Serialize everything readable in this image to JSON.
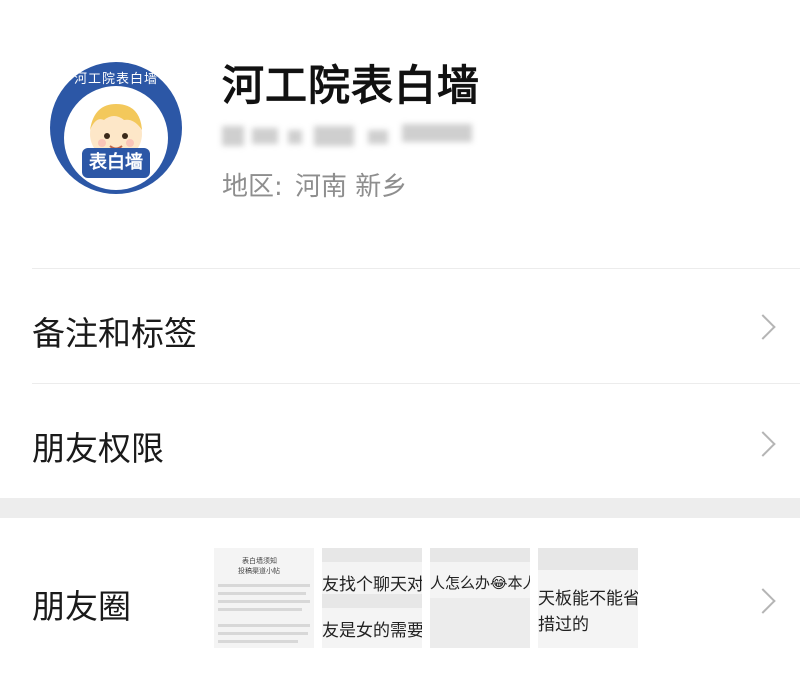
{
  "profile": {
    "avatar": {
      "ring_text": "河工院表白墙",
      "badge_text": "表白墙",
      "brand_color": "#2c57a6"
    },
    "name": "河工院表白墙",
    "wechat_id_blurred": true,
    "region_label": "地区:",
    "region_value": "河南 新乡"
  },
  "rows": {
    "remarks_tags": {
      "label": "备注和标签",
      "icon": "chevron-right-icon"
    },
    "friend_permissions": {
      "label": "朋友权限",
      "icon": "chevron-right-icon"
    },
    "moments": {
      "label": "朋友圈",
      "icon": "chevron-right-icon",
      "thumbnails": [
        {
          "lines": [
            "表白墙须知",
            "投稿渠道小帖"
          ]
        },
        {
          "top_text": "友找个聊天对象",
          "bottom_text": "友是女的需要男的"
        },
        {
          "top_text": "人怎么办😂本人"
        },
        {
          "top_text": "天板能不能省",
          "bottom_text": "措过的"
        }
      ]
    }
  },
  "colors": {
    "background": "#ffffff",
    "section_gap": "#ededed",
    "secondary_text": "#8e8e8e",
    "chevron": "#b5b5b5"
  }
}
